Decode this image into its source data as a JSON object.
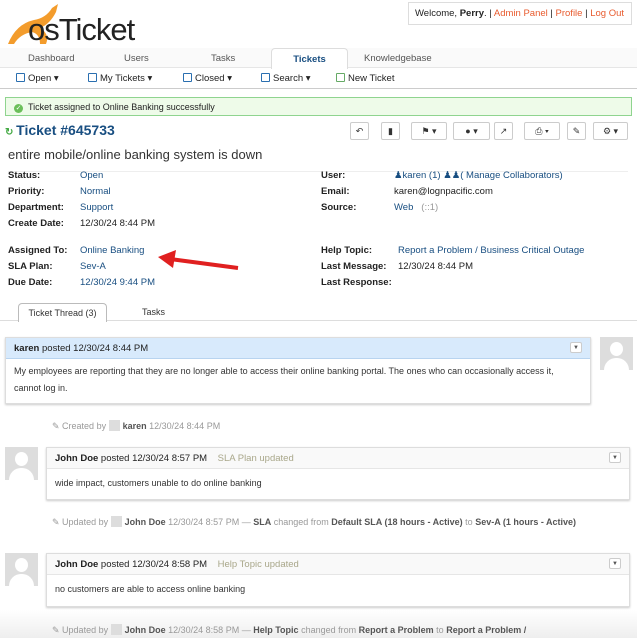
{
  "brand": {
    "name": "osTicket"
  },
  "header": {
    "welcome": "Welcome, ",
    "user": "Perry",
    "sep": ". |",
    "admin_panel": "Admin Panel",
    "profile": "Profile",
    "log_out": "Log Out"
  },
  "nav": {
    "tabs": [
      "Dashboard",
      "Users",
      "Tasks",
      "Tickets",
      "Knowledgebase"
    ],
    "active": "Tickets"
  },
  "subnav": {
    "open": "Open ▾",
    "my_tickets": "My Tickets ▾",
    "closed": "Closed ▾",
    "search": "Search ▾",
    "new_ticket": "New Ticket"
  },
  "alert": {
    "message": "Ticket assigned to Online Banking successfully"
  },
  "ticket": {
    "title": "Ticket #645733",
    "subject": "entire mobile/online banking system is down",
    "left": [
      {
        "label": "Status:",
        "value": "Open"
      },
      {
        "label": "Priority:",
        "value": "Normal"
      },
      {
        "label": "Department:",
        "value": "Support"
      },
      {
        "label": "Create Date:",
        "value": "12/30/24 8:44 PM"
      },
      {
        "label": "Assigned To:",
        "value": "Online Banking"
      },
      {
        "label": "SLA Plan:",
        "value": "Sev-A"
      },
      {
        "label": "Due Date:",
        "value": "12/30/24 9:44 PM"
      }
    ],
    "right": {
      "user_label": "User:",
      "user": "karen (1)",
      "collab": "( Manage Collaborators)",
      "email_label": "Email:",
      "email": "karen@lognpacific.com",
      "source_label": "Source:",
      "source": "Web",
      "source_extra": "(::1)",
      "help_topic_label": "Help Topic:",
      "help_topic": "Report a Problem / Business Critical Outage",
      "last_message_label": "Last Message:",
      "last_message": "12/30/24 8:44 PM",
      "last_response_label": "Last Response:"
    }
  },
  "thread_tabs": {
    "thread": "Ticket Thread (3)",
    "tasks": "Tasks"
  },
  "thread": [
    {
      "author": "karen",
      "posted": " posted 12/30/24 8:44 PM",
      "body": "My employees are reporting that they are no longer able to access their online banking portal. The ones who can occasionally access it, cannot log in."
    },
    {
      "author": "John Doe",
      "posted": " posted 12/30/24 8:57 PM",
      "note": "SLA Plan updated",
      "body": "wide impact, customers unable to do online banking"
    },
    {
      "author": "John Doe",
      "posted": " posted 12/30/24 8:58 PM",
      "note": "Help Topic updated",
      "body": "no customers are able to access online banking"
    }
  ],
  "events": [
    {
      "prefix": "Created by",
      "who": "karen",
      "time": "12/30/24 8:44 PM"
    },
    {
      "prefix": "Updated by",
      "who": "John Doe",
      "time": "12/30/24 8:57 PM —",
      "field": "SLA",
      "mid": "changed from",
      "from": "Default SLA (18 hours - Active)",
      "to_word": "to",
      "to": "Sev-A (1 hours - Active)"
    },
    {
      "prefix": "Updated by",
      "who": "John Doe",
      "time": "12/30/24 8:58 PM —",
      "field": "Help Topic",
      "mid": "changed from",
      "from": "Report a Problem",
      "to_word": "to",
      "to": "Report a Problem /"
    }
  ],
  "colors": {
    "link": "#184e81",
    "brand_orange": "#f39c2c",
    "alert_bg": "#eefbe9",
    "thread_head": "#d8eafc",
    "arrow": "#e02020"
  }
}
